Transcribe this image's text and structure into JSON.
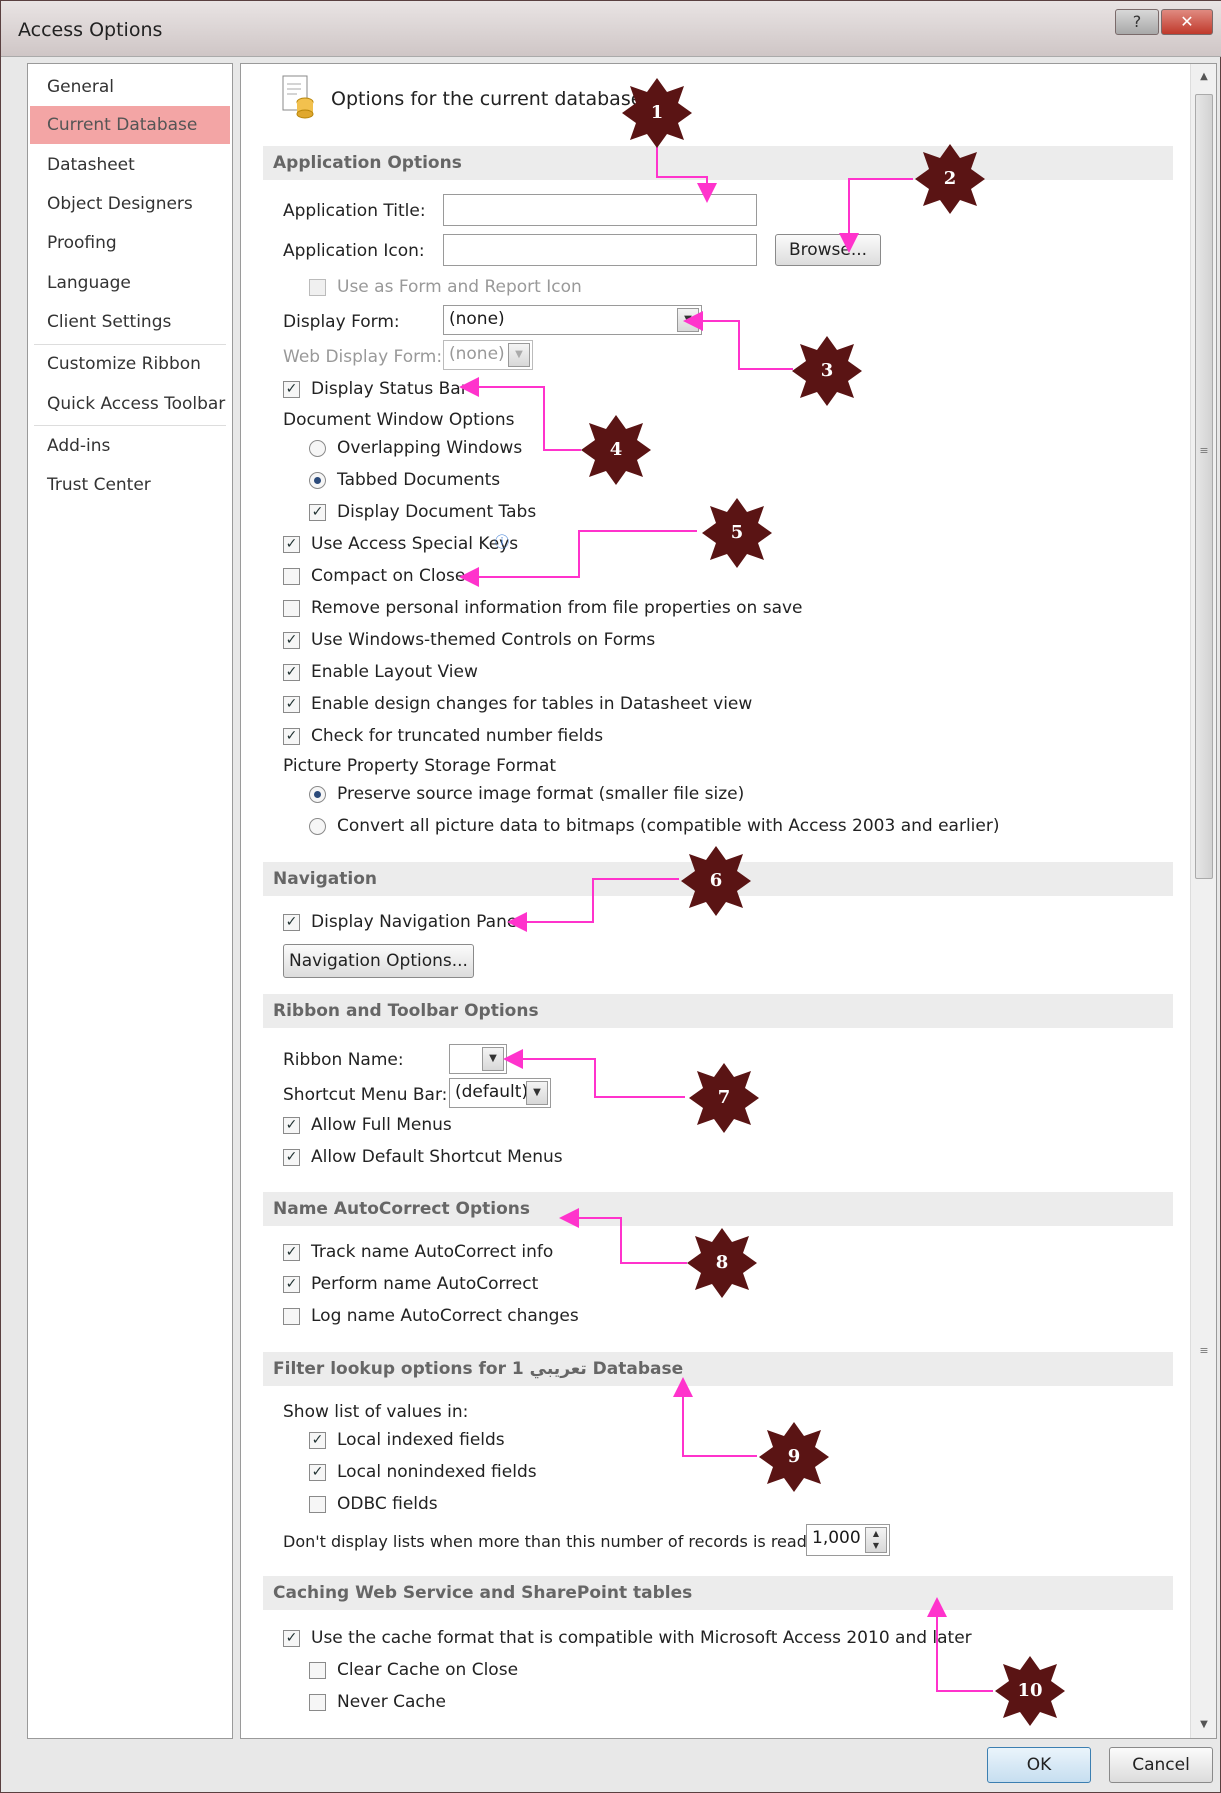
{
  "window": {
    "title": "Access Options",
    "help_glyph": "?",
    "close_glyph": "✕"
  },
  "nav": {
    "items": [
      {
        "label": "General"
      },
      {
        "label": "Current Database",
        "selected": true
      },
      {
        "label": "Datasheet"
      },
      {
        "label": "Object Designers"
      },
      {
        "label": "Proofing"
      },
      {
        "label": "Language"
      },
      {
        "label": "Client Settings"
      },
      {
        "label": "Customize Ribbon"
      },
      {
        "label": "Quick Access Toolbar"
      },
      {
        "label": "Add-ins"
      },
      {
        "label": "Trust Center"
      }
    ]
  },
  "header": {
    "text": "Options for the current database."
  },
  "app_options": {
    "section": "Application Options",
    "title_label": "Application Title:",
    "title_value": "",
    "icon_label": "Application Icon:",
    "icon_value": "",
    "browse": "Browse...",
    "use_icon": "Use as Form and Report Icon",
    "display_form_label": "Display Form:",
    "display_form_value": "(none)",
    "web_form_label": "Web Display Form:",
    "web_form_value": "(none)",
    "status_bar": "Display Status Bar",
    "doc_window": "Document Window Options",
    "overlapping": "Overlapping Windows",
    "tabbed": "Tabbed Documents",
    "doc_tabs": "Display Document Tabs",
    "special_keys": "Use Access Special Keys",
    "compact": "Compact on Close",
    "remove_info": "Remove personal information from file properties on save",
    "themed": "Use Windows-themed Controls on Forms",
    "layout_view": "Enable Layout View",
    "design_changes": "Enable design changes for tables in Datasheet view",
    "truncated": "Check for truncated number fields",
    "picture_storage": "Picture Property Storage Format",
    "preserve": "Preserve source image format (smaller file size)",
    "convert": "Convert all picture data to bitmaps (compatible with Access 2003 and earlier)"
  },
  "navigation": {
    "section": "Navigation",
    "display_pane": "Display Navigation Pane",
    "options_button": "Navigation Options..."
  },
  "ribbon": {
    "section": "Ribbon and Toolbar Options",
    "ribbon_name_label": "Ribbon Name:",
    "ribbon_name_value": "",
    "shortcut_label": "Shortcut Menu Bar:",
    "shortcut_value": "(default)",
    "full_menus": "Allow Full Menus",
    "default_shortcut": "Allow Default Shortcut Menus"
  },
  "autocorrect": {
    "section": "Name AutoCorrect Options",
    "track": "Track name AutoCorrect info",
    "perform": "Perform name AutoCorrect",
    "log": "Log name AutoCorrect changes"
  },
  "filter": {
    "section": "Filter lookup options for تعريبي 1 Database",
    "show_list": "Show list of values in:",
    "local_indexed": "Local indexed fields",
    "local_nonindexed": "Local nonindexed fields",
    "odbc": "ODBC fields",
    "dont_display": "Don't display lists when more than this number of records is read:",
    "records_value": "1,000"
  },
  "caching": {
    "section": "Caching Web Service and SharePoint tables",
    "cache_format": "Use the cache format that is compatible with Microsoft Access 2010 and later",
    "clear_cache": "Clear Cache on Close",
    "never_cache": "Never Cache"
  },
  "footer": {
    "ok": "OK",
    "cancel": "Cancel"
  },
  "badges": [
    "1",
    "2",
    "3",
    "4",
    "5",
    "6",
    "7",
    "8",
    "9",
    "10"
  ],
  "colors": {
    "badge": "#5a1414",
    "arrow": "#ff33cc",
    "nav_selected": "#f3a5a5",
    "titlebar_close": "#c0392b"
  }
}
